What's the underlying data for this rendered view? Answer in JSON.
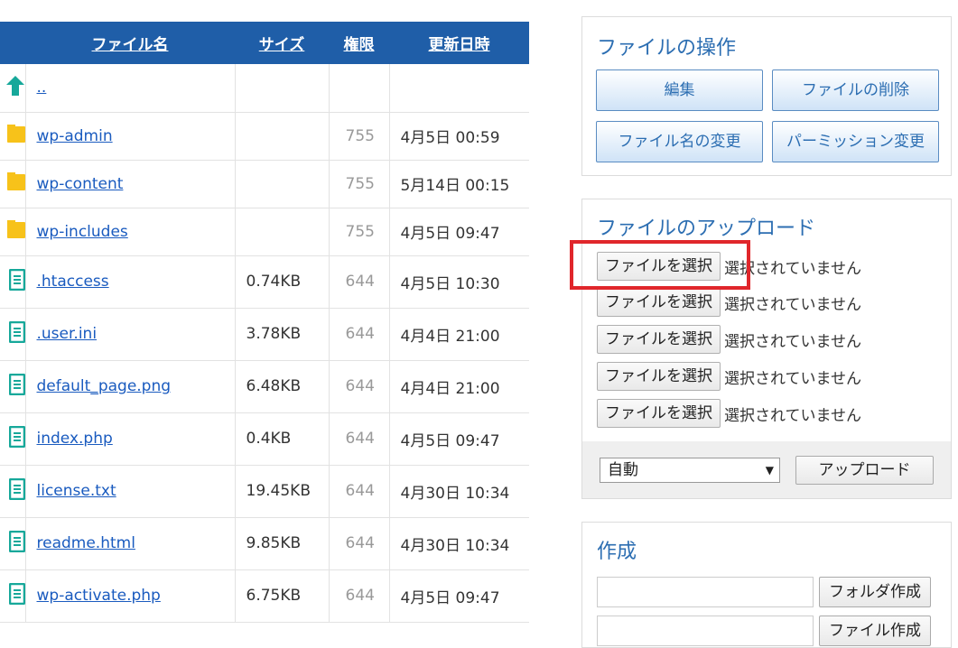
{
  "table": {
    "headers": [
      "",
      "ファイル名",
      "サイズ",
      "権限",
      "更新日時"
    ],
    "rows": [
      {
        "icon": "parent-dir-icon",
        "name": "..",
        "size": "",
        "perm": "",
        "date": ""
      },
      {
        "icon": "folder-icon",
        "name": "wp-admin",
        "size": "",
        "perm": "755",
        "date": "4月5日 00:59"
      },
      {
        "icon": "folder-icon",
        "name": "wp-content",
        "size": "",
        "perm": "755",
        "date": "5月14日 00:15"
      },
      {
        "icon": "folder-icon",
        "name": "wp-includes",
        "size": "",
        "perm": "755",
        "date": "4月5日 09:47"
      },
      {
        "icon": "file-icon",
        "name": ".htaccess",
        "size": "0.74KB",
        "perm": "644",
        "date": "4月5日 10:30"
      },
      {
        "icon": "file-icon",
        "name": ".user.ini",
        "size": "3.78KB",
        "perm": "644",
        "date": "4月4日 21:00"
      },
      {
        "icon": "file-icon",
        "name": "default_page.png",
        "size": "6.48KB",
        "perm": "644",
        "date": "4月4日 21:00"
      },
      {
        "icon": "file-icon",
        "name": "index.php",
        "size": "0.4KB",
        "perm": "644",
        "date": "4月5日 09:47"
      },
      {
        "icon": "file-icon",
        "name": "license.txt",
        "size": "19.45KB",
        "perm": "644",
        "date": "4月30日 10:34"
      },
      {
        "icon": "file-icon",
        "name": "readme.html",
        "size": "9.85KB",
        "perm": "644",
        "date": "4月30日 10:34"
      },
      {
        "icon": "file-icon",
        "name": "wp-activate.php",
        "size": "6.75KB",
        "perm": "644",
        "date": "4月5日 09:47"
      }
    ]
  },
  "ops": {
    "title": "ファイルの操作",
    "edit": "編集",
    "delete": "ファイルの削除",
    "rename": "ファイル名の変更",
    "permission": "パーミッション変更"
  },
  "upload": {
    "title": "ファイルのアップロード",
    "choose_label": "ファイルを選択",
    "no_file": "選択されていません",
    "mode": "自動",
    "submit": "アップロード"
  },
  "create": {
    "title": "作成",
    "folder_button": "フォルダ作成",
    "file_button": "ファイル作成"
  },
  "colors": {
    "header_bg": "#1f5ea8",
    "link": "#1a5bbf",
    "folder": "#f7c21a",
    "file_icon": "#16a89a",
    "highlight": "#e0262b"
  }
}
